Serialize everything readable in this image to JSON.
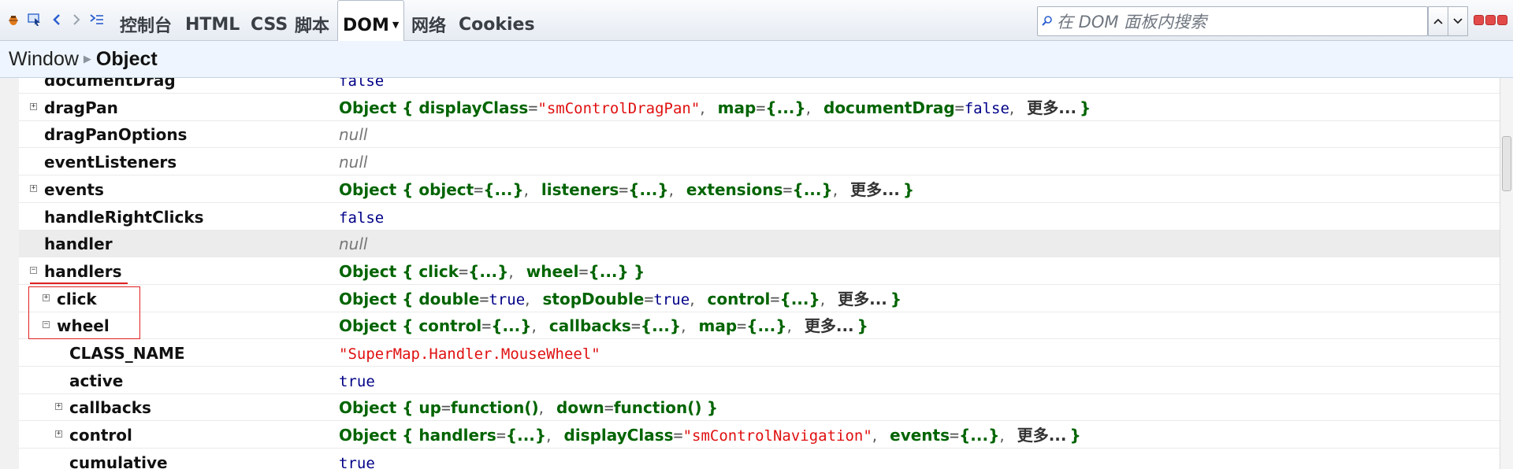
{
  "toolbar": {
    "tabs": [
      {
        "label": "控制台"
      },
      {
        "label": "HTML"
      },
      {
        "label": "CSS"
      },
      {
        "label": "脚本"
      },
      {
        "label": "DOM",
        "active": true,
        "has_dropdown": true
      },
      {
        "label": "网络"
      },
      {
        "label": "Cookies"
      }
    ],
    "icons": [
      "firebug-bug-icon",
      "inspect-element-icon",
      "back-icon",
      "forward-icon",
      "command-line-icon"
    ],
    "search": {
      "placeholder": "在 DOM 面板内搜索",
      "value": ""
    },
    "search_nav": [
      "chevron-up-icon",
      "chevron-down-icon"
    ],
    "window_controls": [
      "minimize-icon",
      "restore-icon",
      "close-icon"
    ]
  },
  "breadcrumb": {
    "items": [
      "Window",
      "Object"
    ]
  },
  "tree": {
    "rows": [
      {
        "key": "documentDrag",
        "value_text": "false",
        "value_kind": "bool",
        "depth": 0,
        "toggle": "none",
        "partial": true
      },
      {
        "key": "dragPan",
        "depth": 0,
        "toggle": "expand",
        "value_kind": "object",
        "value": {
          "type": "Object",
          "props": [
            {
              "name": "displayClass",
              "val": "\"smControlDragPan\"",
              "kind": "str"
            },
            {
              "name": "map",
              "val": "{...}",
              "kind": "obj"
            },
            {
              "name": "documentDrag",
              "val": "false",
              "kind": "bool"
            }
          ],
          "more": "更多..."
        }
      },
      {
        "key": "dragPanOptions",
        "value_text": "null",
        "value_kind": "null",
        "depth": 0,
        "toggle": "none"
      },
      {
        "key": "eventListeners",
        "value_text": "null",
        "value_kind": "null",
        "depth": 0,
        "toggle": "none"
      },
      {
        "key": "events",
        "depth": 0,
        "toggle": "expand",
        "value_kind": "object",
        "value": {
          "type": "Object",
          "props": [
            {
              "name": "object",
              "val": "{...}",
              "kind": "obj"
            },
            {
              "name": "listeners",
              "val": "{...}",
              "kind": "obj"
            },
            {
              "name": "extensions",
              "val": "{...}",
              "kind": "obj"
            }
          ],
          "more": "更多..."
        }
      },
      {
        "key": "handleRightClicks",
        "value_text": "false",
        "value_kind": "bool",
        "depth": 0,
        "toggle": "none"
      },
      {
        "key": "handler",
        "value_text": "null",
        "value_kind": "null",
        "depth": 0,
        "toggle": "none",
        "highlighted": true
      },
      {
        "key": "handlers",
        "depth": 0,
        "toggle": "collapse",
        "value_kind": "object",
        "annotated": "underline",
        "value": {
          "type": "Object",
          "props": [
            {
              "name": "click",
              "val": "{...}",
              "kind": "obj"
            },
            {
              "name": "wheel",
              "val": "{...}",
              "kind": "obj"
            }
          ],
          "more": ""
        }
      },
      {
        "key": "click",
        "depth": 1,
        "toggle": "expand",
        "value_kind": "object",
        "value": {
          "type": "Object",
          "props": [
            {
              "name": "double",
              "val": "true",
              "kind": "bool"
            },
            {
              "name": "stopDouble",
              "val": "true",
              "kind": "bool"
            },
            {
              "name": "control",
              "val": "{...}",
              "kind": "obj"
            }
          ],
          "more": "更多..."
        }
      },
      {
        "key": "wheel",
        "depth": 1,
        "toggle": "collapse",
        "value_kind": "object",
        "value": {
          "type": "Object",
          "props": [
            {
              "name": "control",
              "val": "{...}",
              "kind": "obj"
            },
            {
              "name": "callbacks",
              "val": "{...}",
              "kind": "obj"
            },
            {
              "name": "map",
              "val": "{...}",
              "kind": "obj"
            }
          ],
          "more": "更多..."
        }
      },
      {
        "key": "CLASS_NAME",
        "value_text": "\"SuperMap.Handler.MouseWheel\"",
        "value_kind": "str",
        "depth": 2,
        "toggle": "none"
      },
      {
        "key": "active",
        "value_text": "true",
        "value_kind": "bool",
        "depth": 2,
        "toggle": "none"
      },
      {
        "key": "callbacks",
        "depth": 2,
        "toggle": "expand",
        "value_kind": "object",
        "value": {
          "type": "Object",
          "props": [
            {
              "name": "up",
              "val": "function()",
              "kind": "fn"
            },
            {
              "name": "down",
              "val": "function()",
              "kind": "fn"
            }
          ],
          "more": ""
        }
      },
      {
        "key": "control",
        "depth": 2,
        "toggle": "expand",
        "value_kind": "object",
        "value": {
          "type": "Object",
          "props": [
            {
              "name": "handlers",
              "val": "{...}",
              "kind": "obj"
            },
            {
              "name": "displayClass",
              "val": "\"smControlNavigation\"",
              "kind": "str"
            },
            {
              "name": "events",
              "val": "{...}",
              "kind": "obj"
            }
          ],
          "more": "更多..."
        }
      },
      {
        "key": "cumulative",
        "value_text": "true",
        "value_kind": "bool",
        "depth": 2,
        "toggle": "none"
      }
    ]
  },
  "colors": {
    "object_green": "#006400",
    "string_red": "#e01010",
    "bool_blue": "#000088",
    "null_gray": "#777777",
    "annotation_red": "#e02020",
    "breadcrumb_bg": "#eef5ff"
  }
}
